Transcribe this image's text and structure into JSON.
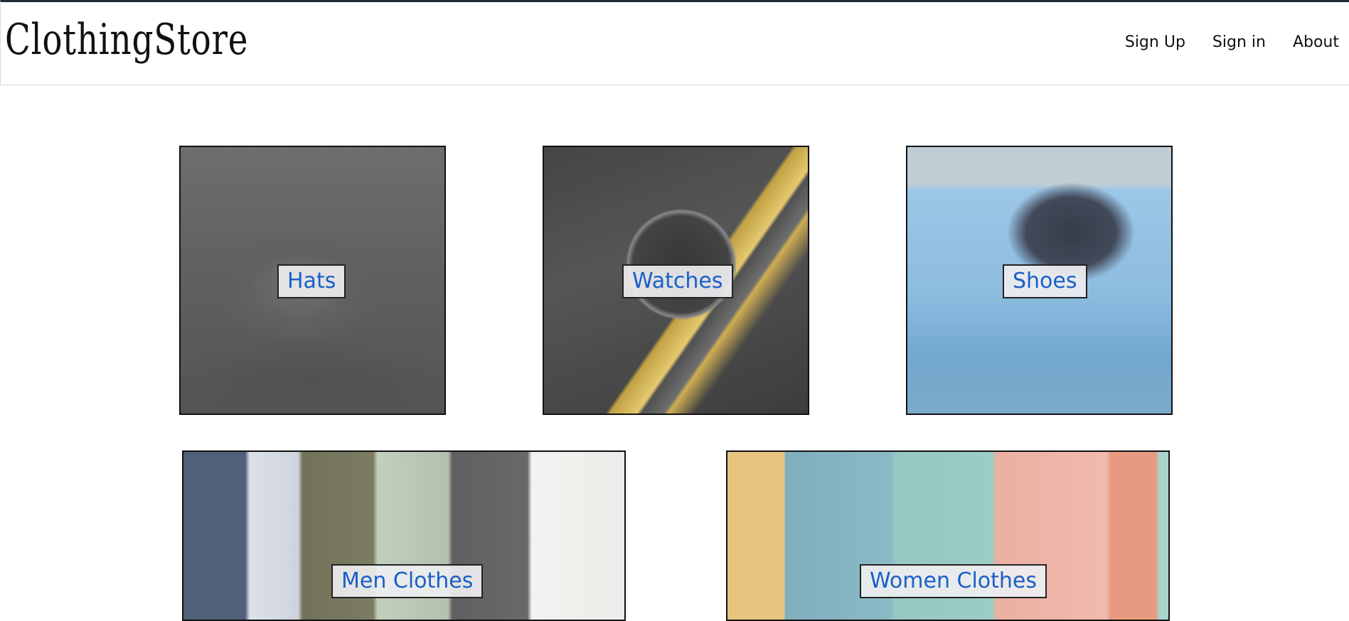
{
  "header": {
    "brand": "ClothingStore",
    "nav": [
      {
        "label": "Sign Up"
      },
      {
        "label": "Sign in"
      },
      {
        "label": "About"
      }
    ]
  },
  "categories": [
    {
      "label": "Hats",
      "image": "baseball-cap-photo"
    },
    {
      "label": "Watches",
      "image": "gold-wristwatch-photo"
    },
    {
      "label": "Shoes",
      "image": "sneakers-photo"
    },
    {
      "label": "Men Clothes",
      "image": "mens-clothing-flatlay-photo"
    },
    {
      "label": "Women Clothes",
      "image": "women-models-photo"
    }
  ],
  "colors": {
    "label_text": "#1a5fc8",
    "label_bg": "#eeeef0",
    "border": "#111111",
    "header_top_border": "#1f2a33"
  }
}
